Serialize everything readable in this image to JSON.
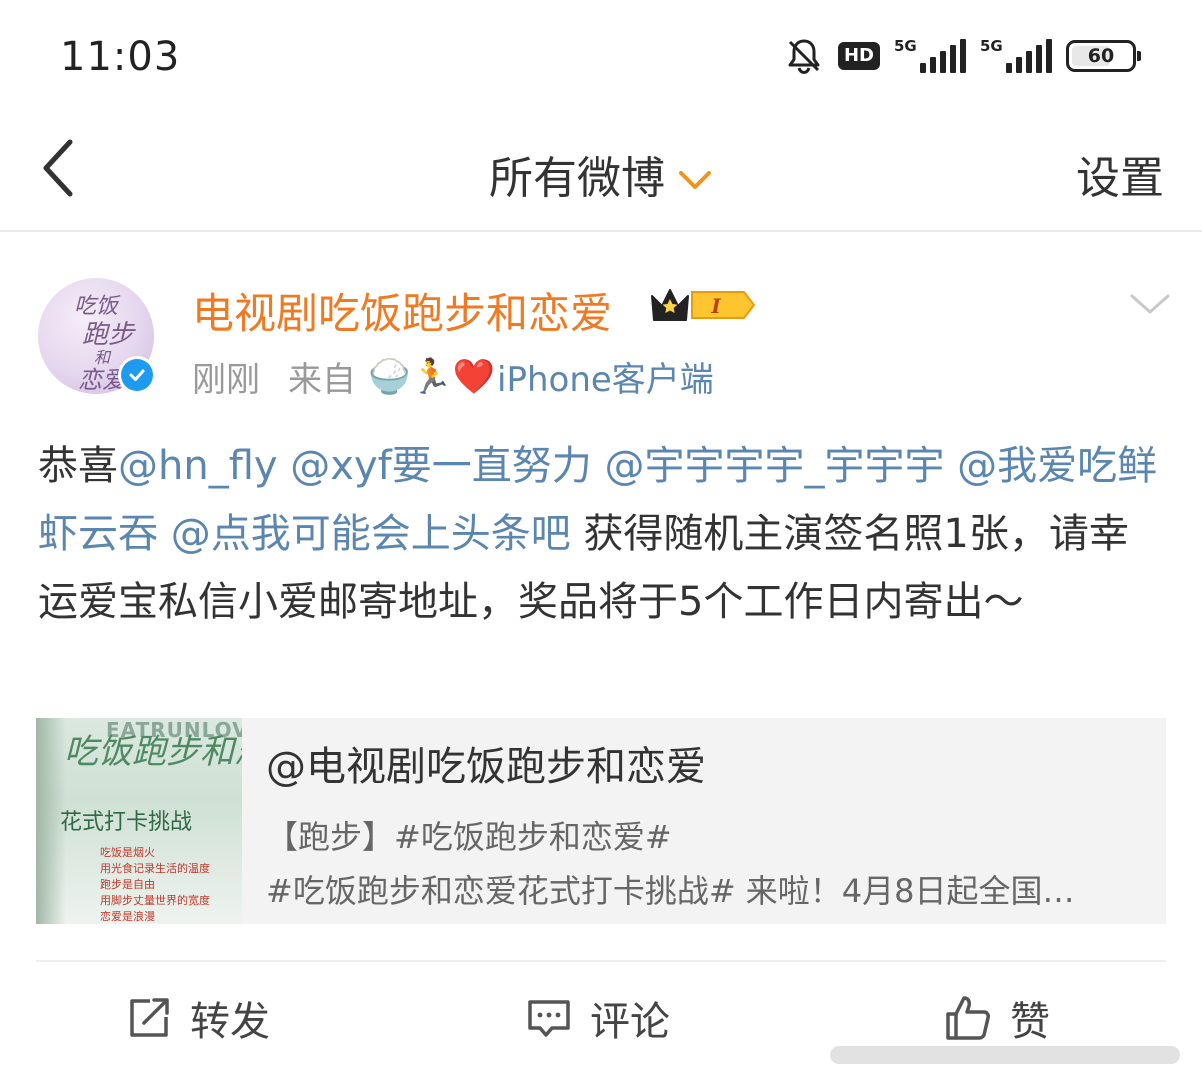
{
  "status_bar": {
    "time": "11:03",
    "hd_label": "HD",
    "network1": "5G",
    "network2": "5G",
    "battery": "60"
  },
  "nav": {
    "title": "所有微博",
    "right_label": "设置"
  },
  "post": {
    "username": "电视剧吃饭跑步和恋爱",
    "level_badge": "I",
    "time": "刚刚",
    "from_label": "来自",
    "source_emoji": "🍚🏃❤️",
    "source": "iPhone客户端",
    "avatar_text": [
      "吃饭",
      "跑步",
      "和",
      "恋爱"
    ],
    "content": {
      "prefix": "恭喜",
      "mentions": [
        "@hn_fly",
        "@xyf要一直努力",
        "@宇宇宇宇_宇宇宇",
        "@我爱吃鲜虾云吞",
        "@点我可能会上头条吧"
      ],
      "body": "获得随机主演签名照1张，请幸运爱宝私信小爱邮寄地址，奖品将于5个工作日内寄出～"
    },
    "card": {
      "title": "@电视剧吃饭跑步和恋爱",
      "line1": "【跑步】#吃饭跑步和恋爱#",
      "line2": "#吃饭跑步和恋爱花式打卡挑战# 来啦！4月8日起全国…",
      "img_eng": "EATRUNLOVE",
      "img_title": "吃饭跑步和恋爱",
      "img_band": "花式打卡挑战",
      "img_lines": [
        "吃饭是烟火",
        "用光食记录生活的温度",
        "跑步是自由",
        "用脚步丈量世界的宽度",
        "恋爱是浪漫"
      ]
    },
    "actions": {
      "repost": "转发",
      "comment": "评论",
      "like": "赞"
    }
  }
}
